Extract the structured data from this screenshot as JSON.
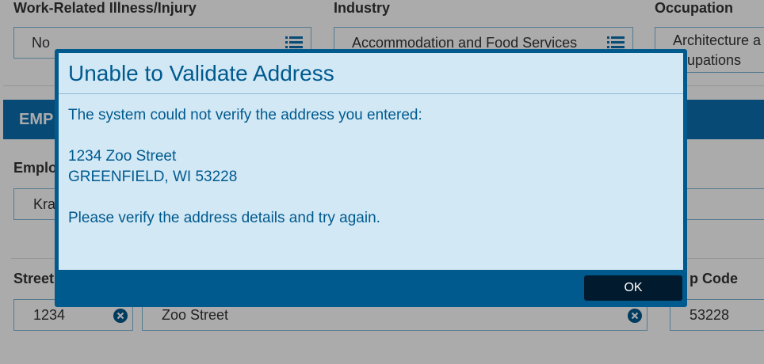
{
  "form": {
    "illness_label": "Work-Related Illness/Injury",
    "illness_value": "No",
    "industry_label": "Industry",
    "industry_value": "Accommodation and Food Services",
    "occupation_label": "Occupation",
    "occupation_value_line1": "Architecture a",
    "occupation_value_line2": "ccupations",
    "employer_section_title": "EMP",
    "employer_label": "Emplo",
    "employer_value": "Kra",
    "street_number_label": "Street",
    "street_number_value": "1234",
    "street_name_value": "Zoo Street",
    "zip_label": "p Code",
    "zip_value": "53228"
  },
  "modal": {
    "title": "Unable to Validate Address",
    "message": "The system could not verify the address you entered:",
    "address_line1": "1234 Zoo Street",
    "address_line2": "GREENFIELD, WI 53228",
    "instruction": "Please verify the address details and try again.",
    "ok_label": "OK"
  },
  "colors": {
    "modal_frame": "#005a8e",
    "modal_body": "#d2e8f5",
    "ok_button": "#021a2e",
    "section_bar": "#0b6fb0"
  }
}
